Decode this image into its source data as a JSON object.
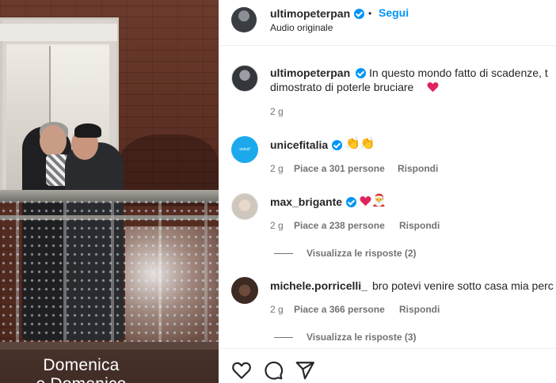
{
  "media": {
    "caption_line1": "Domenica",
    "caption_line2": "e Domenico"
  },
  "header": {
    "username": "ultimopeterpan",
    "separator": "•",
    "follow_label": "Segui",
    "audio": "Audio originale"
  },
  "post": {
    "username": "ultimopeterpan",
    "text_line1": "In questo mondo fatto di scadenze, t",
    "text_line2": "dimostrato di poterle bruciare",
    "time": "2 g"
  },
  "comments": [
    {
      "username": "unicefitalia",
      "time": "2 g",
      "likes": "Piace a 301 persone",
      "reply": "Rispondi"
    },
    {
      "username": "max_brigante",
      "time": "2 g",
      "likes": "Piace a 238 persone",
      "reply": "Rispondi",
      "view_replies": "Visualizza le risposte (2)"
    },
    {
      "username": "michele.porricelli_",
      "text": "bro potevi venire sotto casa mia perc",
      "time": "2 g",
      "likes": "Piace a 366 persone",
      "reply": "Rispondi",
      "view_replies": "Visualizza le risposte (3)"
    }
  ],
  "icons": {
    "like": "heart-outline-icon",
    "comment": "comment-icon",
    "share": "paper-plane-icon",
    "verified": "verified-badge-icon"
  },
  "colors": {
    "link_blue": "#0095f6",
    "muted_text": "#737373",
    "heart_red": "#e0245e"
  }
}
